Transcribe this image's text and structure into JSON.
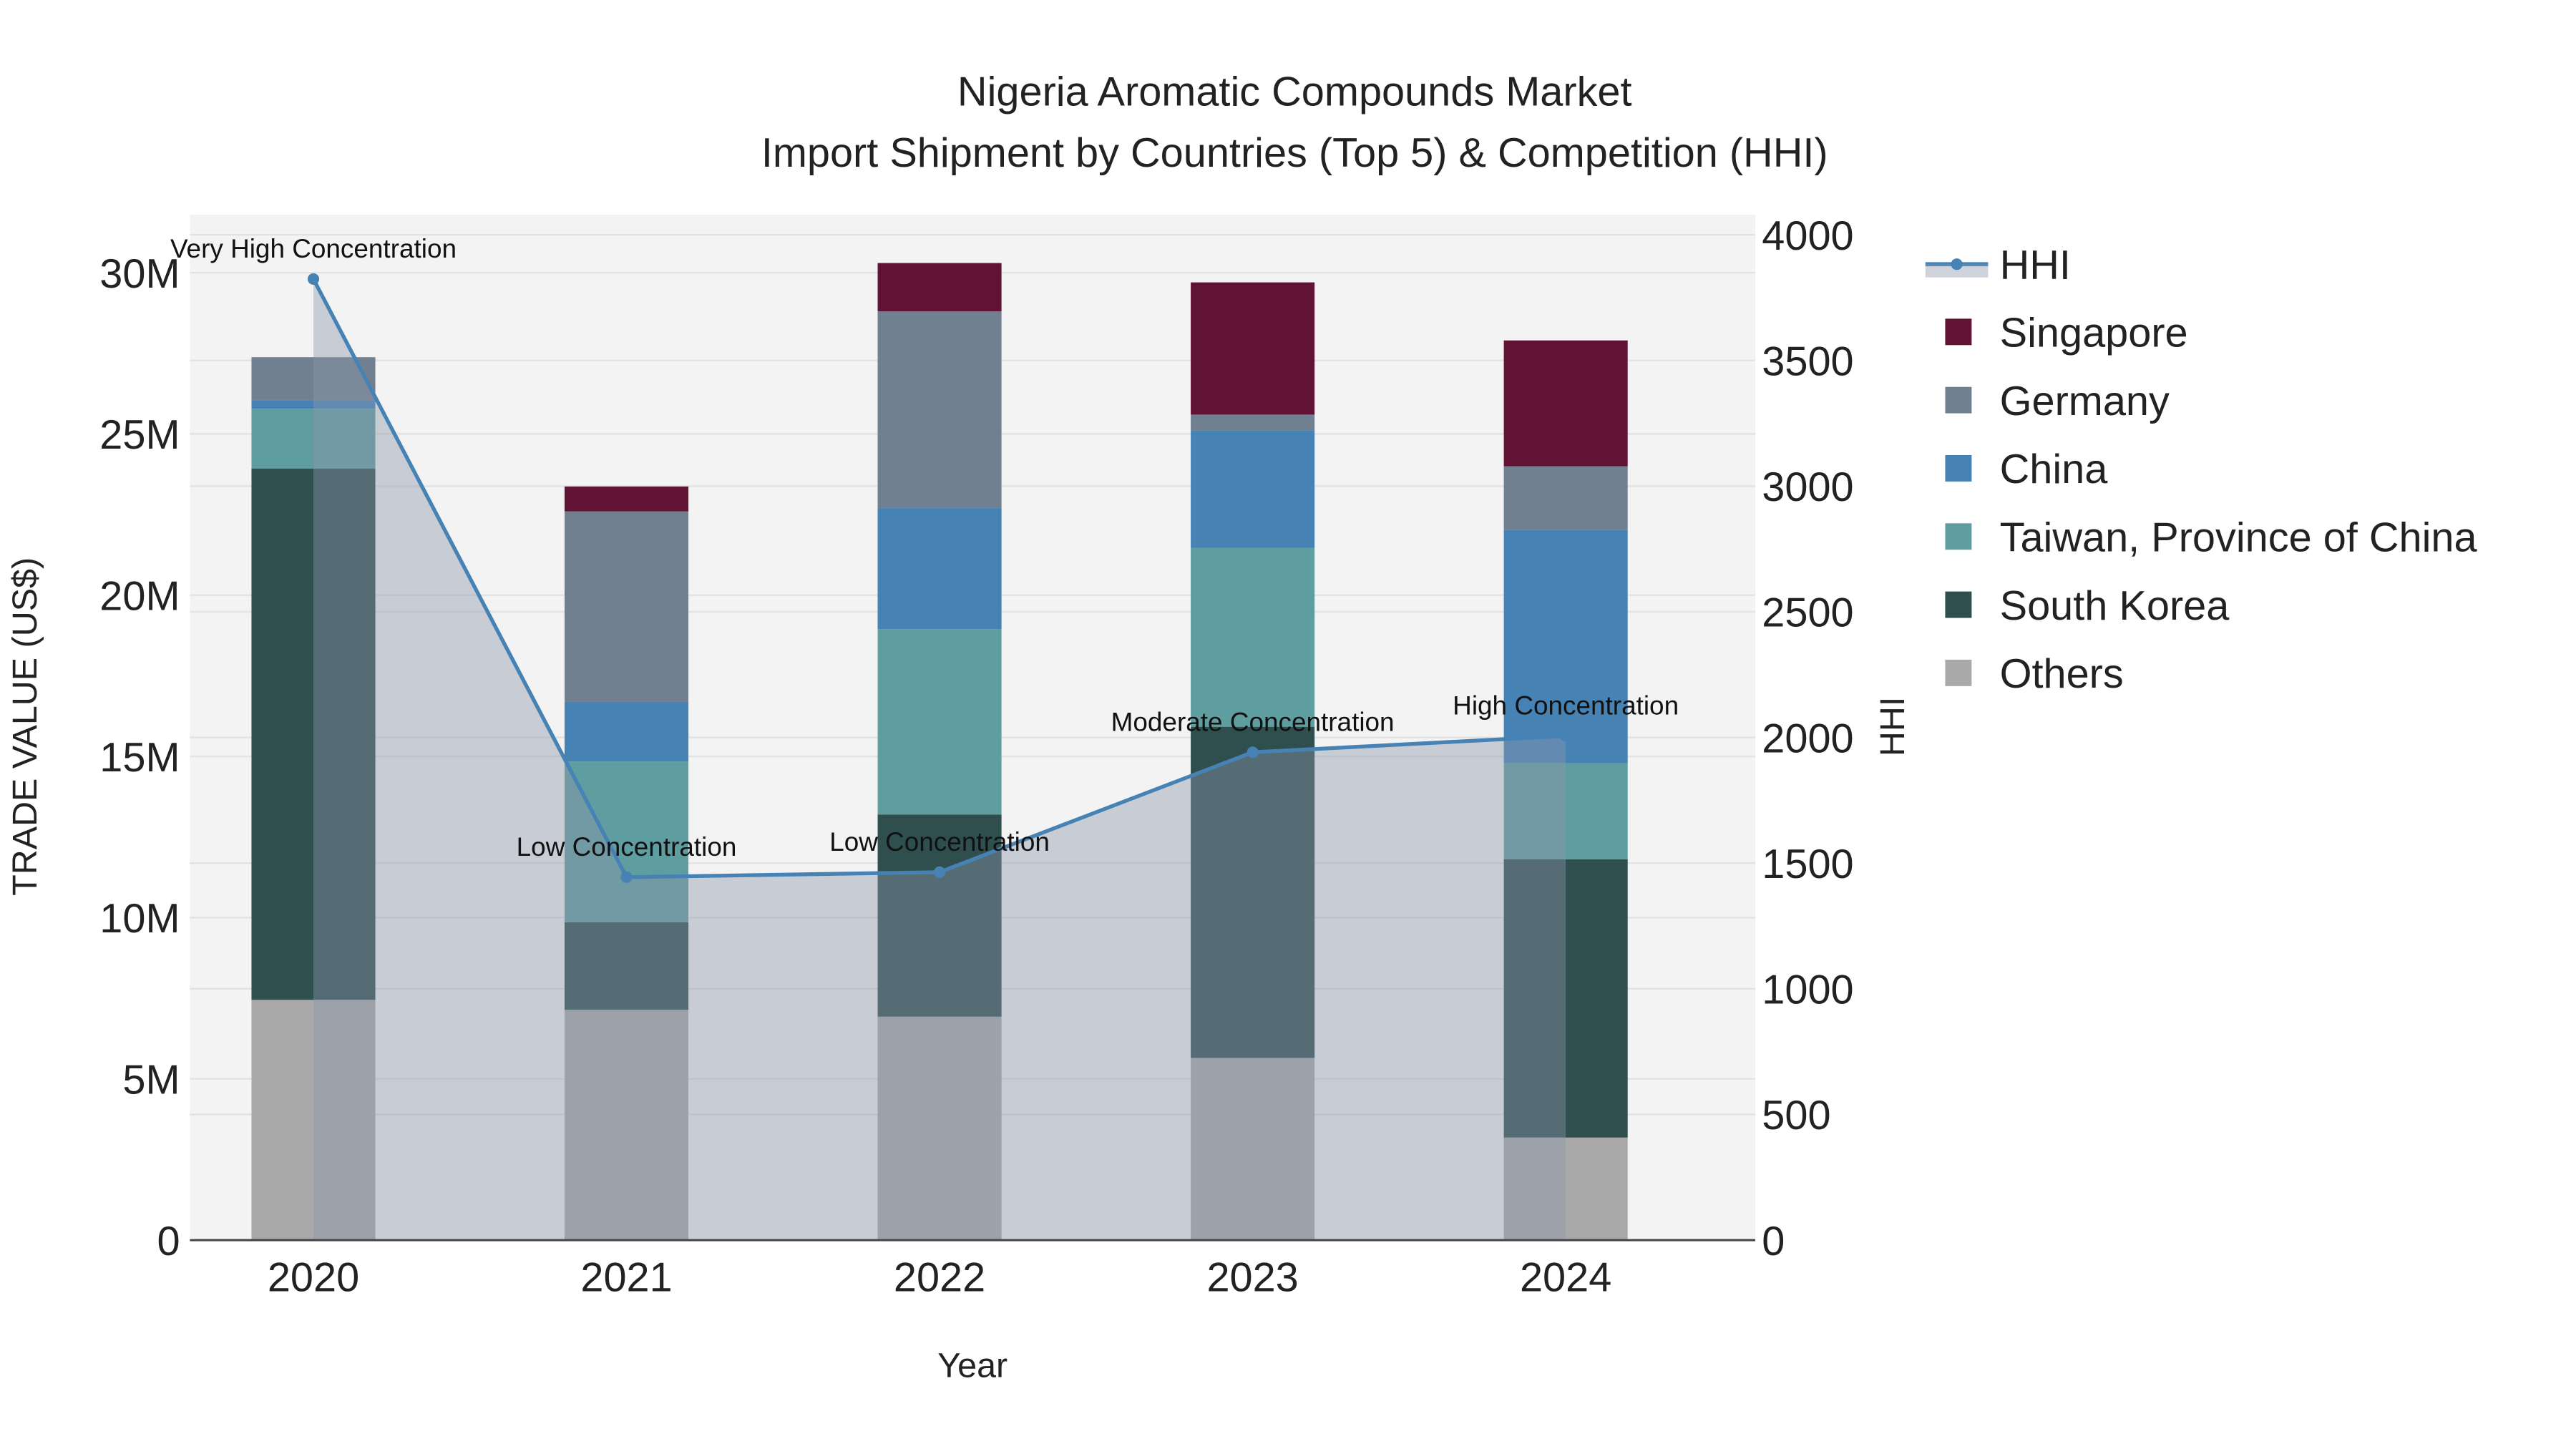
{
  "chart_data": {
    "type": "bar",
    "stacked": true,
    "title": "Nigeria Aromatic Compounds Market",
    "subtitle": "Import Shipment by Countries (Top 5) & Competition (HHI)",
    "xlabel": "Year",
    "ylabel": "TRADE VALUE (US$)",
    "y2label": "HHI",
    "categories": [
      "2020",
      "2021",
      "2022",
      "2023",
      "2024"
    ],
    "ylim": [
      0,
      31800000
    ],
    "y2lim": [
      0,
      4080
    ],
    "yticks": [
      {
        "v": 0,
        "label": "0"
      },
      {
        "v": 5000000,
        "label": "5M"
      },
      {
        "v": 10000000,
        "label": "10M"
      },
      {
        "v": 15000000,
        "label": "15M"
      },
      {
        "v": 20000000,
        "label": "20M"
      },
      {
        "v": 25000000,
        "label": "25M"
      },
      {
        "v": 30000000,
        "label": "30M"
      }
    ],
    "y2ticks": [
      {
        "v": 0,
        "label": "0"
      },
      {
        "v": 500,
        "label": "500"
      },
      {
        "v": 1000,
        "label": "1000"
      },
      {
        "v": 1500,
        "label": "1500"
      },
      {
        "v": 2000,
        "label": "2000"
      },
      {
        "v": 2500,
        "label": "2500"
      },
      {
        "v": 3000,
        "label": "3000"
      },
      {
        "v": 3500,
        "label": "3500"
      },
      {
        "v": 4000,
        "label": "4000"
      }
    ],
    "series": [
      {
        "name": "Others",
        "color": "#a9a9a9",
        "values": [
          7450000,
          7140000,
          6930000,
          5650000,
          3180000
        ]
      },
      {
        "name": "South Korea",
        "color": "#2f4f4f",
        "values": [
          16480000,
          2720000,
          6270000,
          10270000,
          8630000
        ]
      },
      {
        "name": "Taiwan, Province of China",
        "color": "#5f9ea0",
        "values": [
          1850000,
          4980000,
          5750000,
          5550000,
          2980000
        ]
      },
      {
        "name": "China",
        "color": "#4682b4",
        "values": [
          260000,
          1850000,
          3750000,
          3630000,
          7240000
        ]
      },
      {
        "name": "Germany",
        "color": "#708090",
        "values": [
          1340000,
          5910000,
          6100000,
          500000,
          1970000
        ]
      },
      {
        "name": "Singapore",
        "color": "#601335",
        "values": [
          0,
          770000,
          1500000,
          4100000,
          3900000
        ]
      }
    ],
    "hhi": {
      "name": "HHI",
      "color": "#4682b4",
      "values": [
        3824,
        1444,
        1464,
        1941,
        2006
      ],
      "annotations": [
        "Very High Concentration",
        "Low Concentration",
        "Low Concentration",
        "Moderate Concentration",
        "High Concentration"
      ]
    },
    "legend_placement": "right",
    "legend": [
      "HHI",
      "Singapore",
      "Germany",
      "China",
      "Taiwan, Province of China",
      "South Korea",
      "Others"
    ],
    "grid": true
  }
}
